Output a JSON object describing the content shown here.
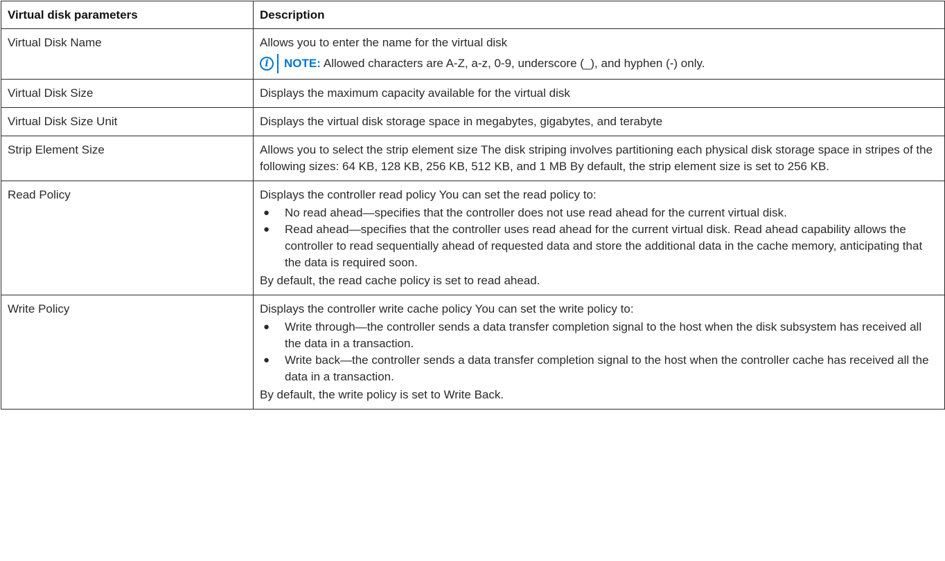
{
  "table": {
    "headers": [
      "Virtual disk parameters",
      "Description"
    ],
    "rows": [
      {
        "param": "Virtual Disk Name",
        "desc": "Allows you to enter the name for the virtual disk",
        "note_label": "NOTE:",
        "note_text": "Allowed characters are A-Z, a-z, 0-9, underscore (_), and hyphen (-) only."
      },
      {
        "param": "Virtual Disk Size",
        "desc": "Displays the maximum capacity available for the virtual disk"
      },
      {
        "param": "Virtual Disk Size Unit",
        "desc": "Displays the virtual disk storage space in megabytes, gigabytes, and terabyte"
      },
      {
        "param": "Strip Element Size",
        "desc": "Allows you to select the strip element size The disk striping involves partitioning each physical disk storage space in stripes of the following sizes: 64 KB, 128 KB, 256 KB, 512 KB, and 1 MB By default, the strip element size is set to 256 KB."
      },
      {
        "param": "Read Policy",
        "desc": "Displays the controller read policy You can set the read policy to:",
        "bullets": [
          "No read ahead—specifies that the controller does not use read ahead for the current virtual disk.",
          "Read ahead—specifies that the controller uses read ahead for the current virtual disk. Read ahead capability allows the controller to read sequentially ahead of requested data and store the additional data in the cache memory, anticipating that the data is required soon."
        ],
        "footer": "By default, the read cache policy is set to read ahead."
      },
      {
        "param": "Write Policy",
        "desc": "Displays the controller write cache policy You can set the write policy to:",
        "bullets": [
          "Write through—the controller sends a data transfer completion signal to the host when the disk subsystem has received all the data in a transaction.",
          "Write back—the controller sends a data transfer completion signal to the host when the controller cache has received all the data in a transaction."
        ],
        "footer": "By default, the write policy is set to Write Back."
      }
    ]
  },
  "icons": {
    "note": "info-circle-icon",
    "bullet": "●",
    "accent_color": "#0076ce"
  }
}
